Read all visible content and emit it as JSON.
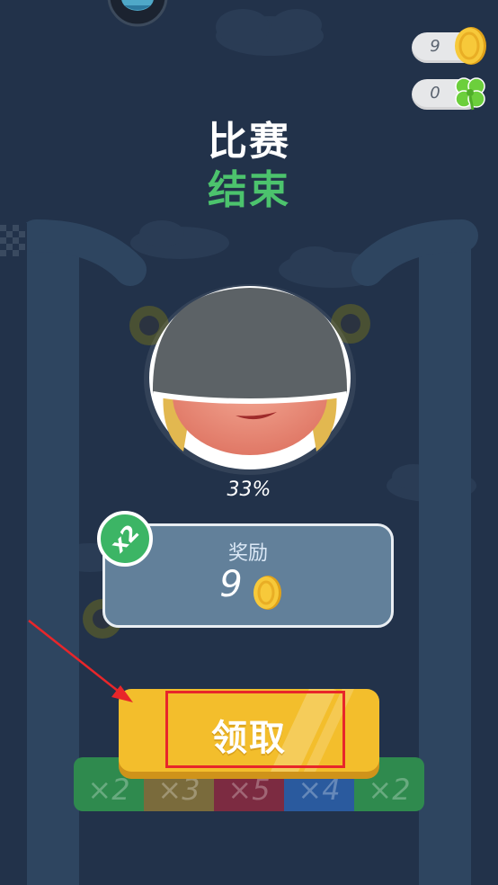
{
  "currency": {
    "coins": "9",
    "clovers": "0"
  },
  "title": {
    "line1": "比赛",
    "line2": "结束"
  },
  "progress": {
    "percent_text": "33%",
    "percent_value": 33
  },
  "reward": {
    "label": "奖励",
    "amount": "9",
    "multiplier_badge": "x2"
  },
  "multiplier_strip": [
    {
      "label": "×2",
      "color": "#2f8a4e"
    },
    {
      "label": "×3",
      "color": "#7a6b3c"
    },
    {
      "label": "×5",
      "color": "#7c2b41"
    },
    {
      "label": "×4",
      "color": "#2a5a9e"
    },
    {
      "label": "×2",
      "color": "#2f8a4e"
    }
  ],
  "claim_button": {
    "label": "领取"
  },
  "colors": {
    "background": "#22324a",
    "title_accent": "#4cc36d",
    "button": "#f3be2c",
    "annotation": "#e8262a"
  },
  "icons": {
    "top_badge": "bird-icon",
    "coin": "coin-icon",
    "clover": "clover-icon"
  }
}
